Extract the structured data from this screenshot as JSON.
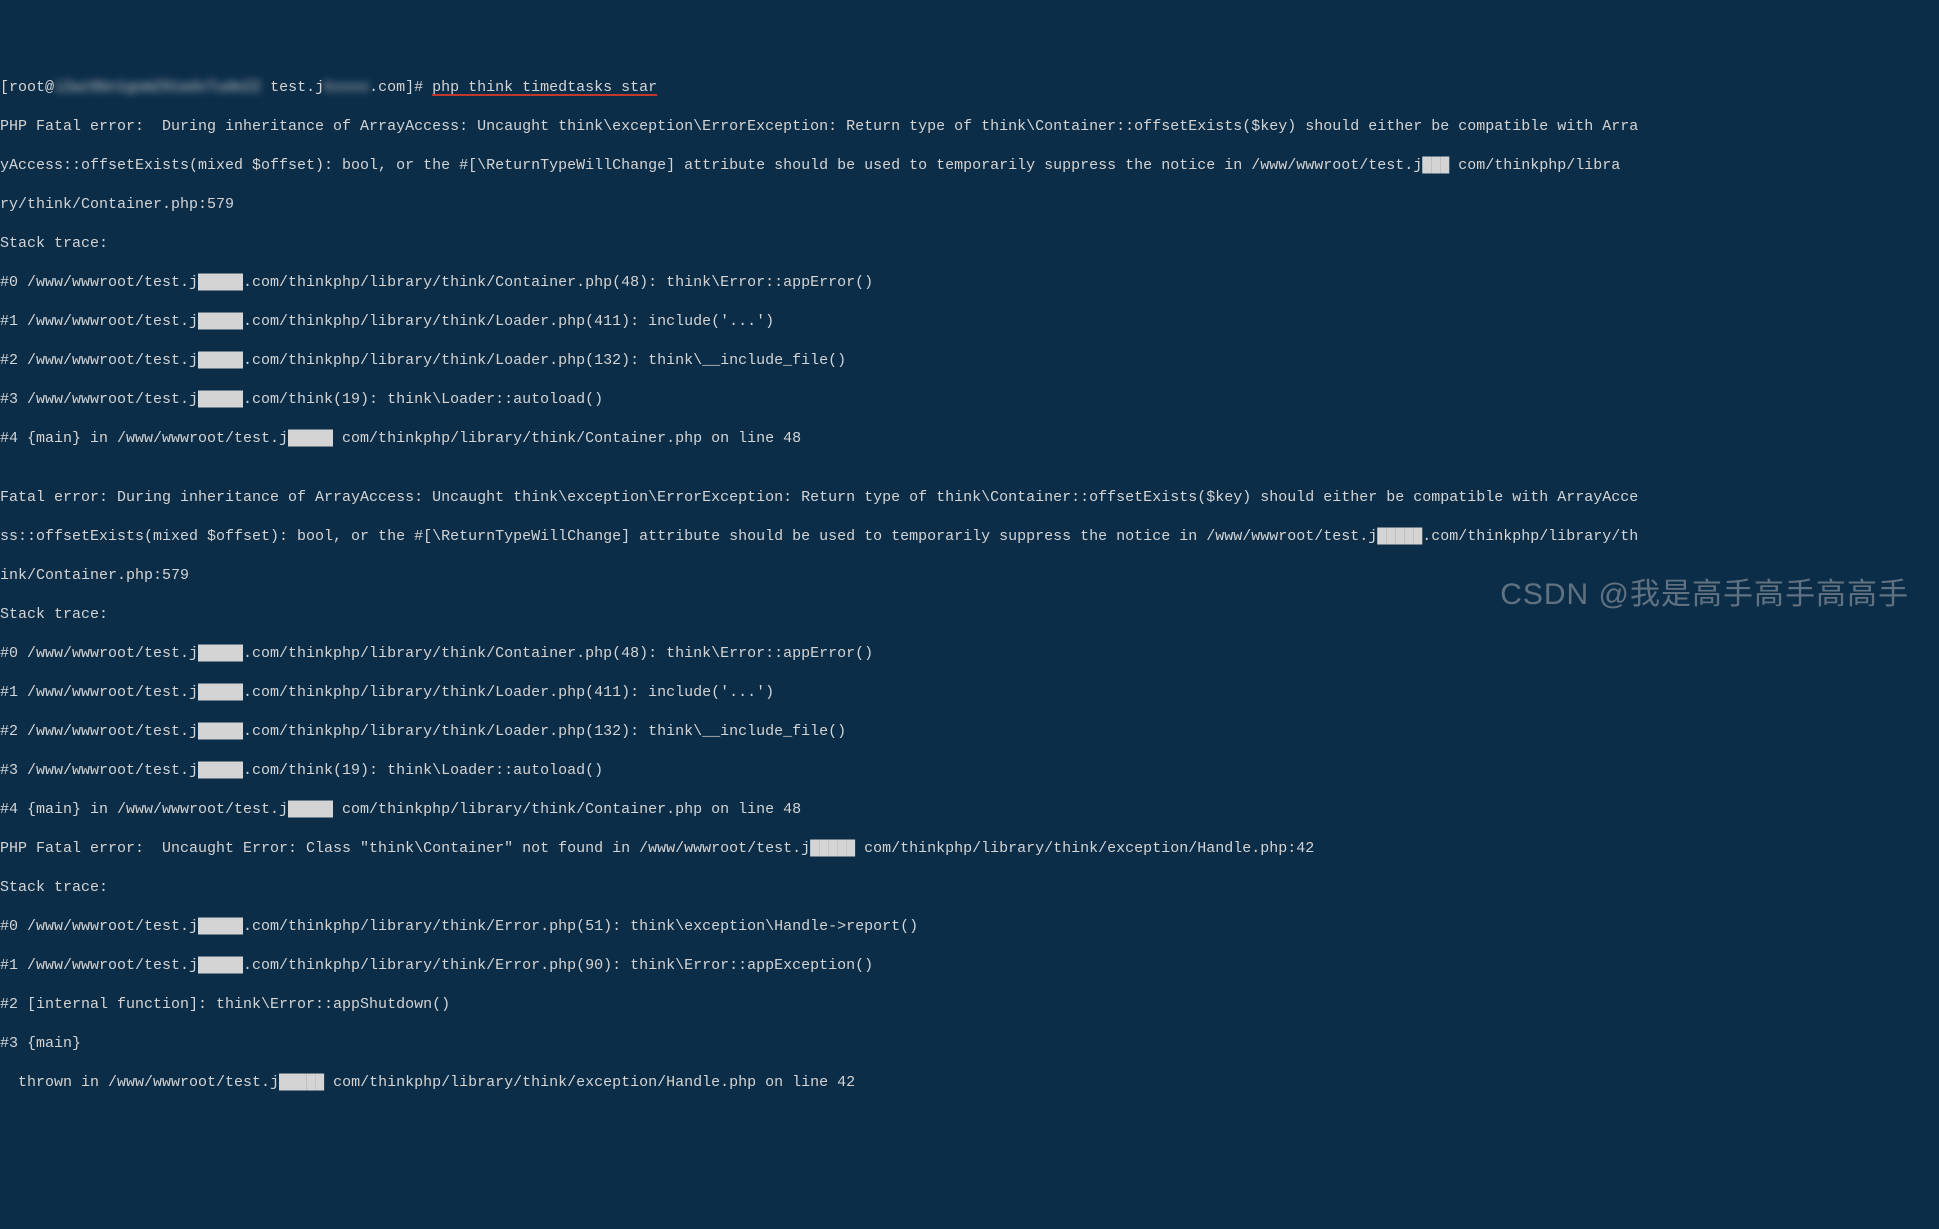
{
  "prompt": {
    "prefix": "[root@",
    "host_blur": "iZwz9bn1gomZ91adxTudeZZ",
    "mid": " test.j",
    "domain_blur": "kxxxx",
    "suffix": ".com]# ",
    "command": "php think timedtasks star"
  },
  "lines": [
    "PHP Fatal error:  During inheritance of ArrayAccess: Uncaught think\\exception\\ErrorException: Return type of think\\Container::offsetExists($key) should either be compatible with Arra",
    "yAccess::offsetExists(mixed $offset): bool, or the #[\\ReturnTypeWillChange] attribute should be used to temporarily suppress the notice in /www/wwwroot/test.j███ com/thinkphp/libra",
    "ry/think/Container.php:579",
    "Stack trace:",
    "#0 /www/wwwroot/test.j█████.com/thinkphp/library/think/Container.php(48): think\\Error::appError()",
    "#1 /www/wwwroot/test.j█████.com/thinkphp/library/think/Loader.php(411): include('...')",
    "#2 /www/wwwroot/test.j█████.com/thinkphp/library/think/Loader.php(132): think\\__include_file()",
    "#3 /www/wwwroot/test.j█████.com/think(19): think\\Loader::autoload()",
    "#4 {main} in /www/wwwroot/test.j█████ com/thinkphp/library/think/Container.php on line 48",
    "",
    "Fatal error: During inheritance of ArrayAccess: Uncaught think\\exception\\ErrorException: Return type of think\\Container::offsetExists($key) should either be compatible with ArrayAcce",
    "ss::offsetExists(mixed $offset): bool, or the #[\\ReturnTypeWillChange] attribute should be used to temporarily suppress the notice in /www/wwwroot/test.j█████.com/thinkphp/library/th",
    "ink/Container.php:579",
    "Stack trace:",
    "#0 /www/wwwroot/test.j█████.com/thinkphp/library/think/Container.php(48): think\\Error::appError()",
    "#1 /www/wwwroot/test.j█████.com/thinkphp/library/think/Loader.php(411): include('...')",
    "#2 /www/wwwroot/test.j█████.com/thinkphp/library/think/Loader.php(132): think\\__include_file()",
    "#3 /www/wwwroot/test.j█████.com/think(19): think\\Loader::autoload()",
    "#4 {main} in /www/wwwroot/test.j█████ com/thinkphp/library/think/Container.php on line 48",
    "PHP Fatal error:  Uncaught Error: Class \"think\\Container\" not found in /www/wwwroot/test.j█████ com/thinkphp/library/think/exception/Handle.php:42",
    "Stack trace:",
    "#0 /www/wwwroot/test.j█████.com/thinkphp/library/think/Error.php(51): think\\exception\\Handle->report()",
    "#1 /www/wwwroot/test.j█████.com/thinkphp/library/think/Error.php(90): think\\Error::appException()",
    "#2 [internal function]: think\\Error::appShutdown()",
    "#3 {main}",
    "  thrown in /www/wwwroot/test.j█████ com/thinkphp/library/think/exception/Handle.php on line 42"
  ],
  "watermark": "CSDN @我是高手高手高高手"
}
